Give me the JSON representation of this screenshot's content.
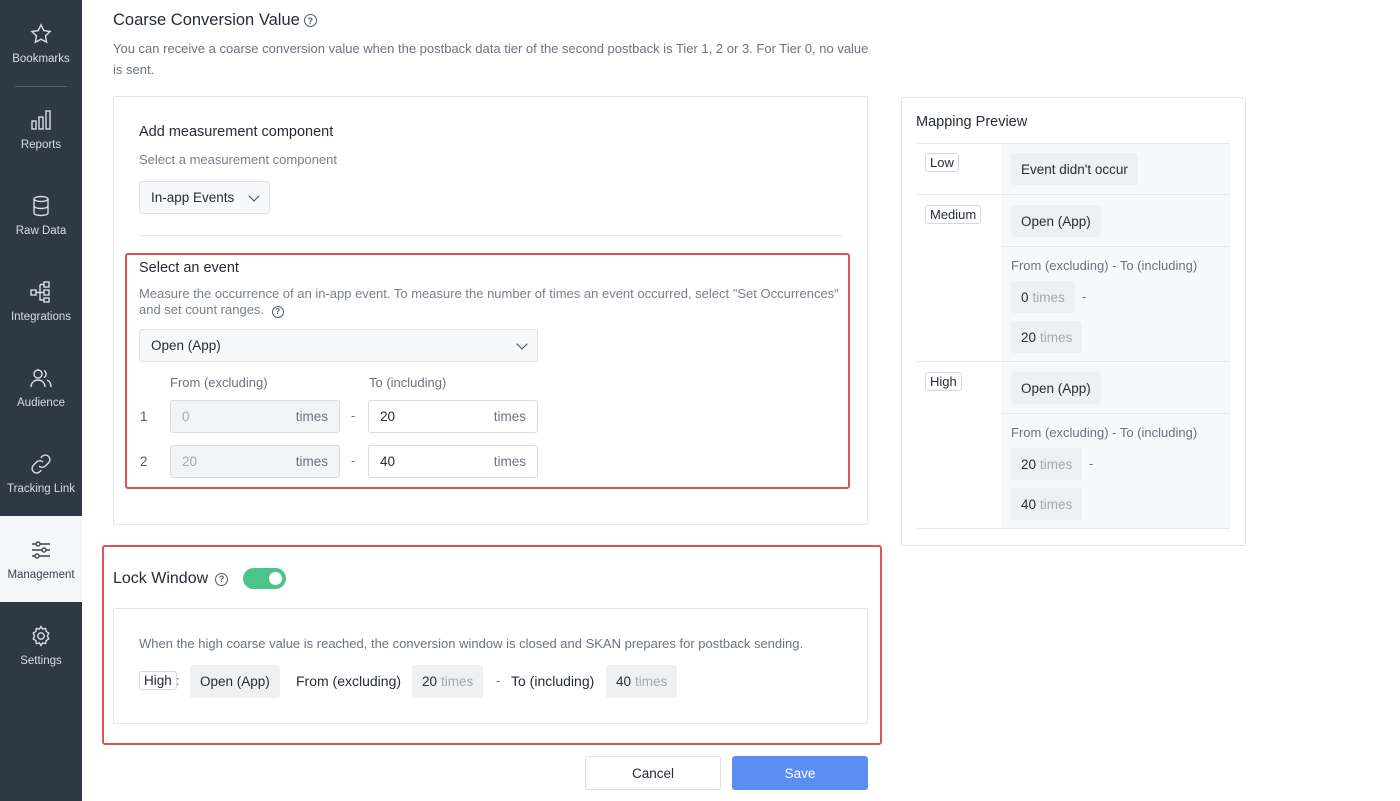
{
  "sidebar": {
    "items": [
      {
        "label": "Bookmarks",
        "icon": "star-icon"
      },
      {
        "label": "Reports",
        "icon": "bar-chart-icon"
      },
      {
        "label": "Raw Data",
        "icon": "database-icon"
      },
      {
        "label": "Integrations",
        "icon": "integrations-icon"
      },
      {
        "label": "Audience",
        "icon": "users-icon"
      },
      {
        "label": "Tracking Link",
        "icon": "link-icon"
      },
      {
        "label": "Management",
        "icon": "sliders-icon",
        "active": true
      },
      {
        "label": "Settings",
        "icon": "gear-icon"
      }
    ]
  },
  "coarse": {
    "title": "Coarse Conversion Value",
    "description": "You can receive a coarse conversion value when the postback data tier of the second postback is Tier 1, 2 or 3. For Tier 0, no value is sent."
  },
  "measurement": {
    "heading": "Add measurement component",
    "subheading": "Select a measurement component",
    "component_value": "In-app Events"
  },
  "event": {
    "heading": "Select an event",
    "description": "Measure the occurrence of an in-app event. To measure the number of times an event occurred, select \"Set Occurrences\" and set count ranges.",
    "selected_event": "Open (App)",
    "from_label": "From (excluding)",
    "to_label": "To (including)",
    "unit": "times",
    "dash": "-",
    "rows": [
      {
        "index": "1",
        "from": "0",
        "to": "20"
      },
      {
        "index": "2",
        "from": "20",
        "to": "40"
      }
    ]
  },
  "preview": {
    "title": "Mapping Preview",
    "range_label": "From (excluding) - To (including)",
    "unit": "times",
    "dash": "-",
    "rows": [
      {
        "level": "Low",
        "event": "Event didn't occur"
      },
      {
        "level": "Medium",
        "event": "Open (App)",
        "from": "0",
        "to": "20"
      },
      {
        "level": "High",
        "event": "Open (App)",
        "from": "20",
        "to": "40"
      }
    ]
  },
  "lock": {
    "title": "Lock Window",
    "enabled": true,
    "description": "When the high coarse value is reached, the conversion window is closed and SKAN prepares for postback sending.",
    "level": "High",
    "colon": ":",
    "event": "Open (App)",
    "from_label": "From (excluding)",
    "from": "20",
    "dash": "-",
    "to_label": "To (including)",
    "to": "40",
    "unit": "times"
  },
  "actions": {
    "cancel": "Cancel",
    "save": "Save"
  },
  "colors": {
    "sidebar": "#2f3845",
    "toggle_on": "#4cc38a",
    "primary": "#5a8ef0",
    "highlight": "#e05252"
  }
}
